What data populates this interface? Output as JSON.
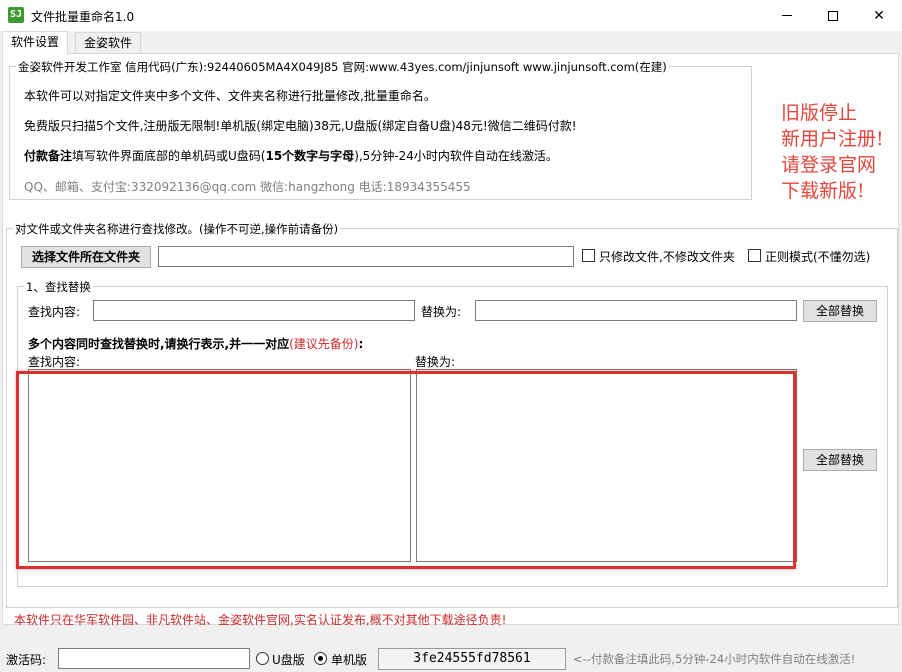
{
  "window": {
    "title": "文件批量重命名1.0",
    "icon": "SJ"
  },
  "tabs": [
    {
      "label": "软件设置"
    },
    {
      "label": "金姿软件"
    }
  ],
  "info": {
    "legend": "金姿软件开发工作室 信用代码(广东):92440605MA4X049J85 官网:www.43yes.com/jinjunsoft  www.jinjunsoft.com(在建)",
    "line1": "本软件可以对指定文件夹中多个文件、文件夹名称进行批量修改,批量重命名。",
    "line2": "免费版只扫描5个文件,注册版无限制!单机版(绑定电脑)38元,U盘版(绑定自备U盘)48元!微信二维码付款!",
    "line3_bold": "付款备注",
    "line3_mid": "填写软件界面底部的单机码或U盘码(",
    "line3_bold2": "15个数字与字母",
    "line3_end": "),5分钟-24小时内软件自动在线激活。",
    "contact": "QQ、邮箱、支付宝:332092136@qq.com    微信:hangzhong    电话:18934355455"
  },
  "notice": {
    "line1": "旧版停止",
    "line2": "新用户注册!",
    "line3": "请登录官网",
    "line4": "下载新版!"
  },
  "rename": {
    "legend": "对文件或文件夹名称进行查找修改。(操作不可逆,操作前请备份)",
    "select_folder_button": "选择文件所在文件夹",
    "folder_path": "",
    "only_files_label": "只修改文件,不修改文件夹",
    "regex_label": "正则模式(不懂勿选)"
  },
  "find_replace": {
    "legend": "1、查找替换",
    "find_label": "查找内容:",
    "find_value": "",
    "replace_label": "替换为:",
    "replace_value": "",
    "replace_all_button": "全部替换",
    "multi_hint": "多个内容同时查找替换时,请换行表示,并一一对应",
    "multi_hint_red": "(建议先备份)",
    "multi_hint_end": ":",
    "multi_find_label": "查找内容:",
    "multi_replace_label": "替换为:",
    "multi_replace_all_button": "全部替换"
  },
  "footer_notice": "本软件只在华军软件园、非凡软件站、金姿软件官网,实名认证发布,概不对其他下载途径负责!",
  "status": {
    "activation_label": "激活码:",
    "activation_value": "",
    "usb_label": "U盘版",
    "standalone_label": "单机版",
    "machine_code": "3fe24555fd78561",
    "hint": "<--付款备注填此码,5分钟-24小时内软件自动在线激活!"
  },
  "colors": {
    "notice": "#e5463c",
    "highlight": "#d93030",
    "warning": "#cc2a2a"
  }
}
